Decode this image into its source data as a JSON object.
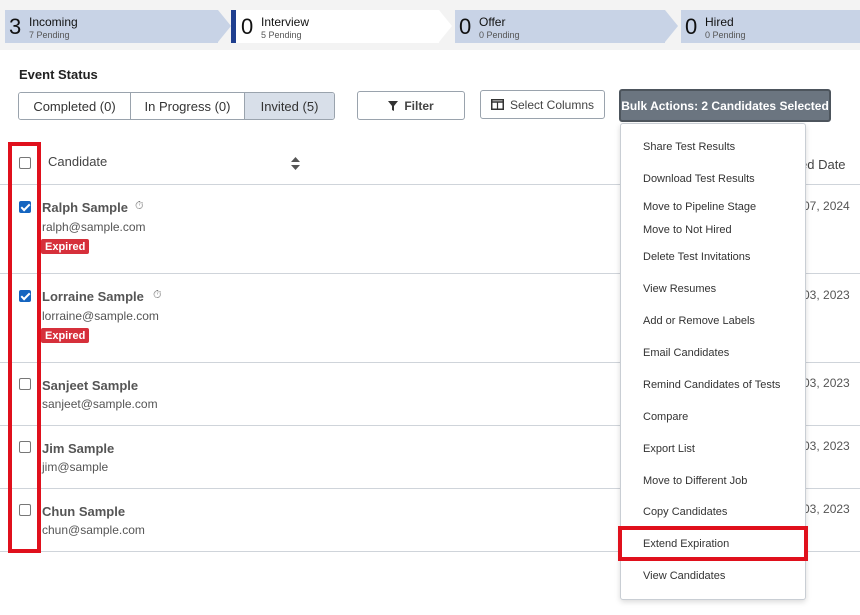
{
  "pipeline": [
    {
      "count": "3",
      "name": "Incoming",
      "sub": "7 Pending",
      "active": false
    },
    {
      "count": "0",
      "name": "Interview",
      "sub": "5 Pending",
      "active": true
    },
    {
      "count": "0",
      "name": "Offer",
      "sub": "0 Pending",
      "active": false
    },
    {
      "count": "0",
      "name": "Hired",
      "sub": "0 Pending",
      "active": false
    }
  ],
  "event_status": {
    "title": "Event Status",
    "tabs": [
      "Completed (0)",
      "In Progress (0)",
      "Invited (5)"
    ],
    "selected": "Invited (5)"
  },
  "toolbar": {
    "filter_label": "Filter",
    "columns_label": "Select Columns",
    "bulk_label": "Bulk Actions: 2 Candidates Selected"
  },
  "table": {
    "col_candidate": "Candidate",
    "col_date": "ed Date",
    "rows": [
      {
        "name": "Ralph Sample",
        "email": "ralph@sample.com",
        "badge": "Expired",
        "date": "07, 2024",
        "checked": true
      },
      {
        "name": "Lorraine Sample",
        "email": "lorraine@sample.com",
        "badge": "Expired",
        "date": "03, 2023",
        "checked": true
      },
      {
        "name": "Sanjeet Sample",
        "email": "sanjeet@sample.com",
        "badge": "",
        "date": "03, 2023",
        "checked": false
      },
      {
        "name": "Jim Sample",
        "email": "jim@sample",
        "badge": "",
        "date": "03, 2023",
        "checked": false
      },
      {
        "name": "Chun Sample",
        "email": "chun@sample.com",
        "badge": "",
        "date": "03, 2023",
        "checked": false
      }
    ]
  },
  "bulk_menu": [
    "Share Test Results",
    "Download Test Results",
    "Move to Pipeline Stage",
    "Move to Not Hired",
    "Delete Test Invitations",
    "View Resumes",
    "Add or Remove Labels",
    "Email Candidates",
    "Remind Candidates of Tests",
    "Compare",
    "Export List",
    "Move to Different Job",
    "Copy Candidates",
    "Extend Expiration",
    "View Candidates"
  ],
  "highlighted_menu_item": "Extend Expiration",
  "colors": {
    "stage": "#c8d3e6",
    "active_bar": "#1f3f8f",
    "bulk_button": "#6b7580",
    "expired_badge": "#d6303b",
    "highlight_frame": "#e0101c",
    "checkbox_checked": "#1565c0"
  }
}
